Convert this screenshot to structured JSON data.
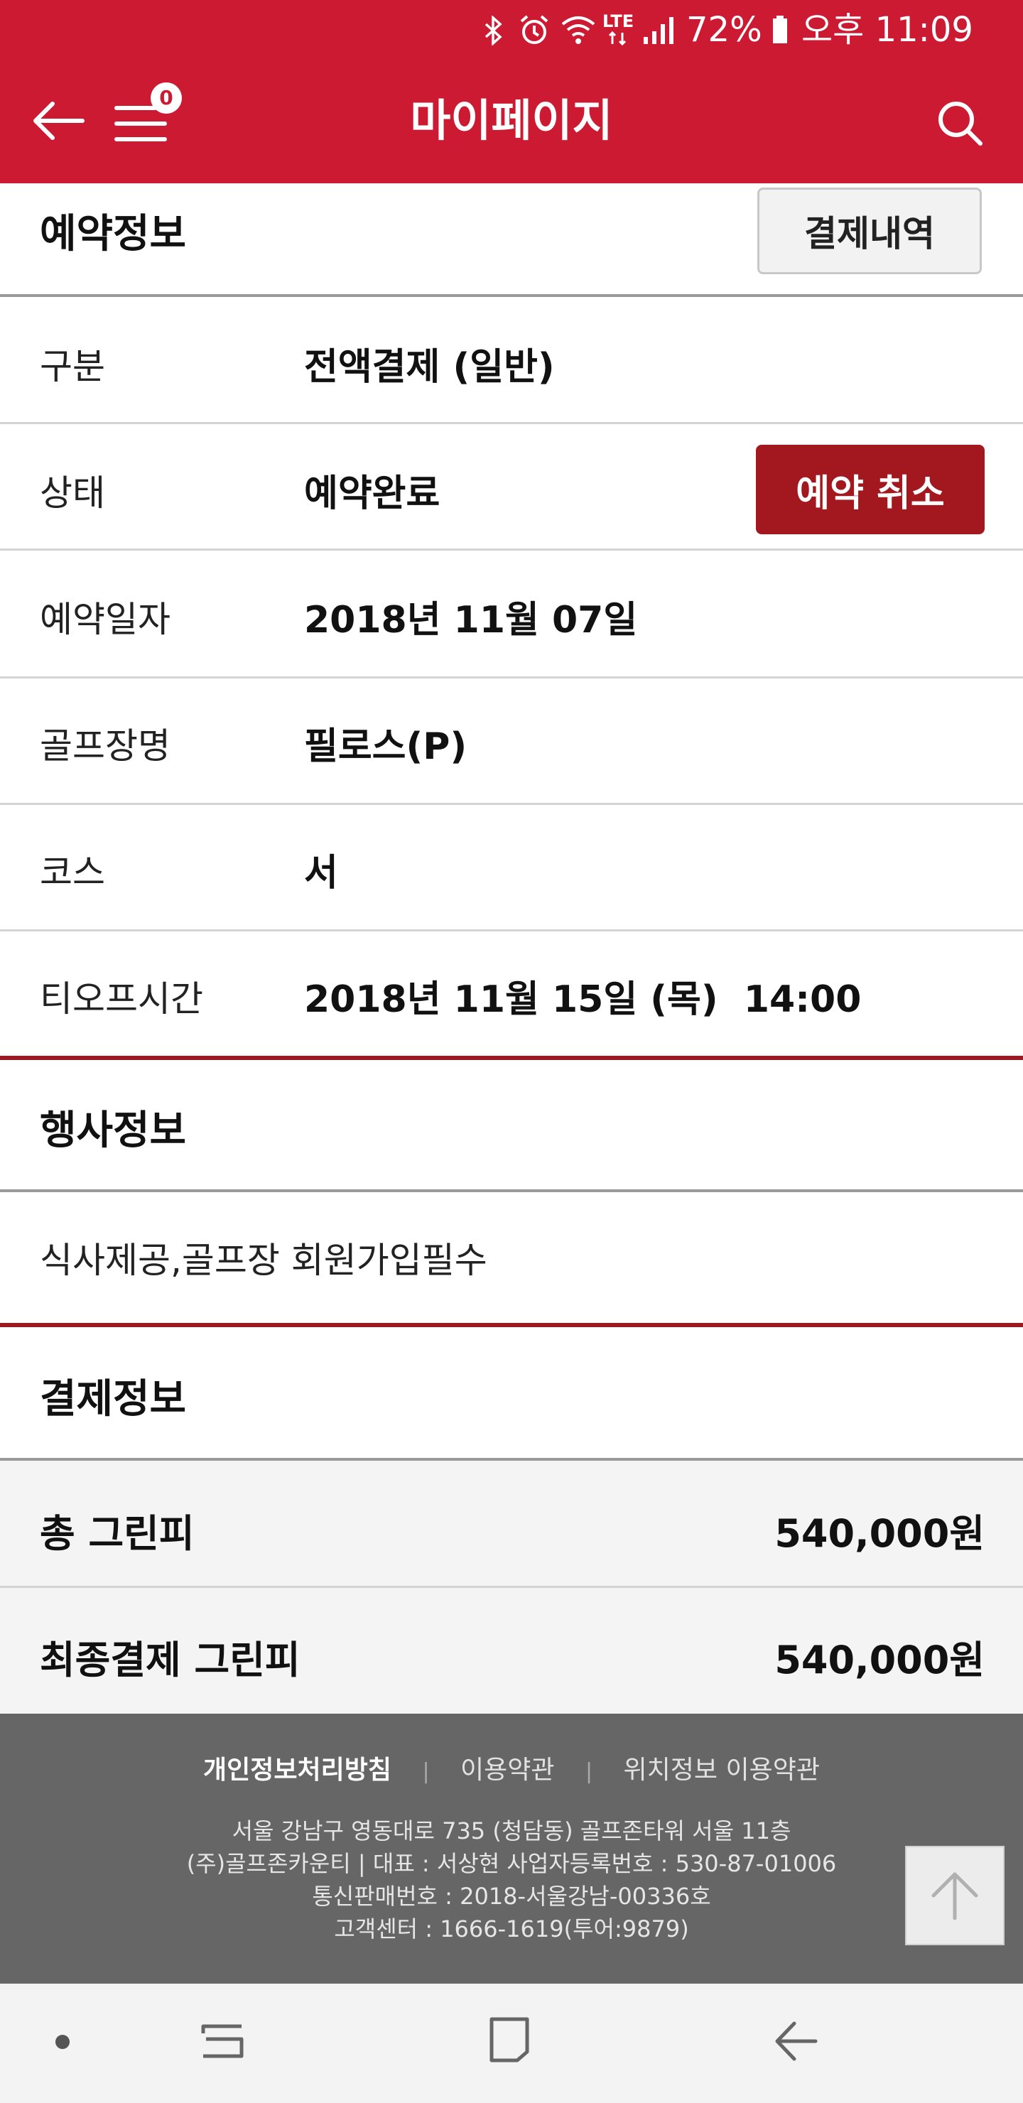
{
  "status_bar": {
    "battery": "72%",
    "time": "오후 11:09",
    "network": "LTE"
  },
  "header": {
    "title": "마이페이지",
    "menu_badge": "0",
    "accent": "#cc1a32"
  },
  "reservation": {
    "section_title": "예약정보",
    "payment_history_button": "결제내역",
    "cancel_button": "예약 취소",
    "rows": [
      {
        "label": "구분",
        "value": "전액결제 (일반)"
      },
      {
        "label": "상태",
        "value": "예약완료"
      },
      {
        "label": "예약일자",
        "value": "2018년 11월 07일"
      },
      {
        "label": "골프장명",
        "value": "필로스(P)"
      },
      {
        "label": "코스",
        "value": "서"
      },
      {
        "label": "티오프시간",
        "value": "2018년 11월 15일 (목)  14:00"
      }
    ]
  },
  "event": {
    "section_title": "행사정보",
    "text": "식사제공,골프장 회원가입필수"
  },
  "payment": {
    "section_title": "결제정보",
    "rows": [
      {
        "label": "총 그린피",
        "value": "540,000원"
      },
      {
        "label": "최종결제 그린피",
        "value": "540,000원"
      }
    ]
  },
  "footer": {
    "links": [
      "개인정보처리방침",
      "이용약관",
      "위치정보 이용약관"
    ],
    "separator": "|",
    "info": [
      "서울 강남구 영동대로 735 (청담동)  골프존타워 서울 11층",
      "(주)골프존카운티 | 대표 : 서상현 사업자등록번호 : 530-87-01006",
      "통신판매번호 : 2018-서울강남-00336호",
      "고객센터 : 1666-1619(투어:9879)"
    ]
  }
}
